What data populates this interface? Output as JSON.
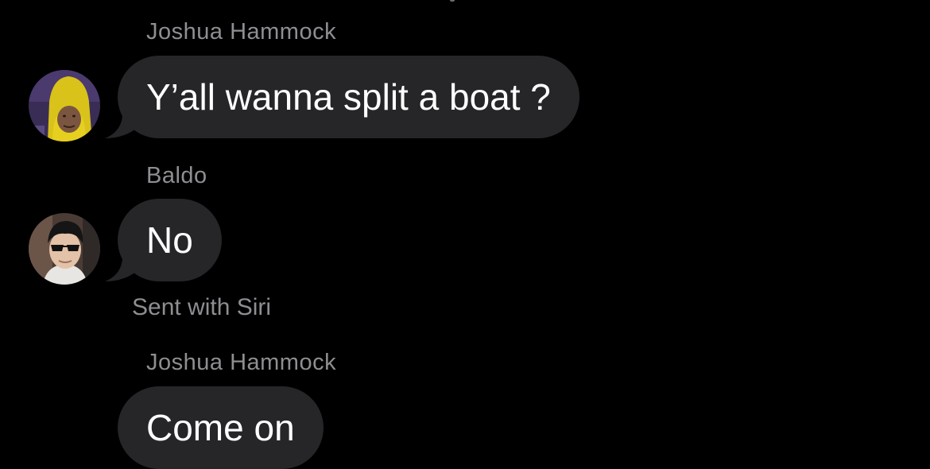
{
  "messages": [
    {
      "sender": "Joshua Hammock",
      "text": "Y’all wanna split a boat ?",
      "avatar": "yellow-hooded-person-avatar"
    },
    {
      "sender": "Baldo",
      "text": "No",
      "avatar": "person-with-sunglasses-avatar",
      "note": "Sent with Siri"
    },
    {
      "sender": "Joshua Hammock",
      "text": "Come on",
      "avatar": ""
    }
  ],
  "colors": {
    "background": "#000000",
    "bubble": "#262629",
    "sender_label": "#8e8e93",
    "message_text": "#ffffff"
  }
}
